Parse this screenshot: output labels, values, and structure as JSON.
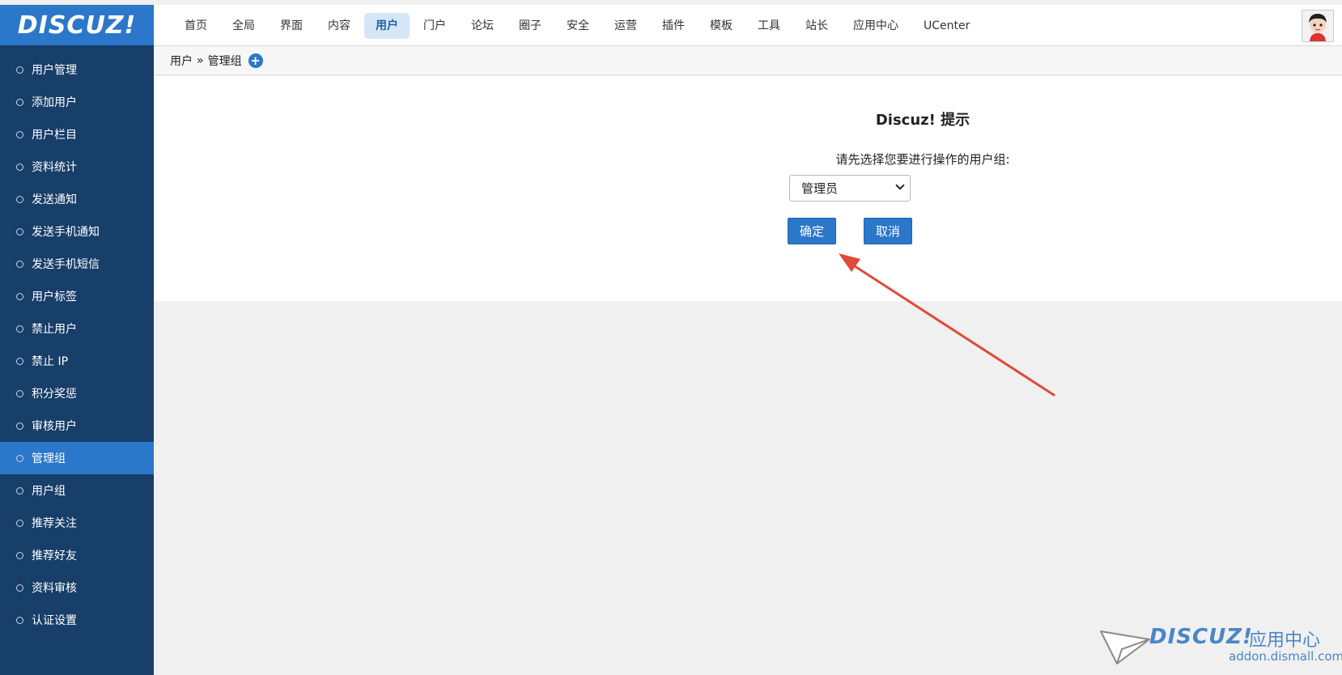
{
  "logo": {
    "text": "DISCUZ!"
  },
  "topnav": {
    "items": [
      "首页",
      "全局",
      "界面",
      "内容",
      "用户",
      "门户",
      "论坛",
      "圈子",
      "安全",
      "运营",
      "插件",
      "模板",
      "工具",
      "站长",
      "应用中心",
      "UCenter"
    ],
    "active": "用户"
  },
  "sidebar": {
    "items": [
      "用户管理",
      "添加用户",
      "用户栏目",
      "资料统计",
      "发送通知",
      "发送手机通知",
      "发送手机短信",
      "用户标签",
      "禁止用户",
      "禁止 IP",
      "积分奖惩",
      "审核用户",
      "管理组",
      "用户组",
      "推荐关注",
      "推荐好友",
      "资料审核",
      "认证设置"
    ],
    "active": "管理组"
  },
  "breadcrumb": {
    "parent": "用户",
    "separator": "»",
    "current": "管理组"
  },
  "dialog": {
    "title": "Discuz! 提示",
    "message": "请先选择您要进行操作的用户组:",
    "select_value": "管理员",
    "ok_label": "确定",
    "cancel_label": "取消"
  },
  "watermark": {
    "logo": "DISCUZ!",
    "subtitle": "应用中心",
    "url": "addon.dismall.com"
  },
  "colors": {
    "accent": "#2b77c9",
    "sidebar_bg": "#183f6a",
    "arrow": "#e04a3a"
  }
}
